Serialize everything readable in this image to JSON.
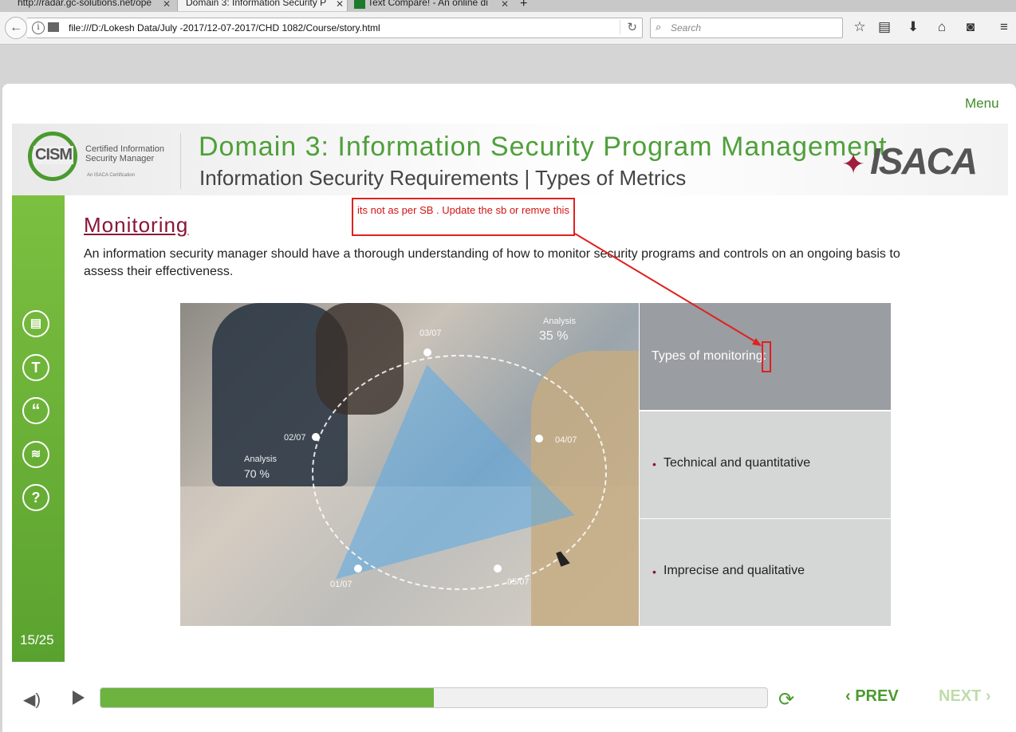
{
  "browser": {
    "tabs": [
      {
        "label": "http://radar.gc-solutions.net/ope"
      },
      {
        "label": "Domain 3: Information Security P"
      },
      {
        "label": "Text Compare! - An online di"
      }
    ],
    "url": "file:///D:/Lokesh Data/July -2017/12-07-2017/CHD 1082/Course/story.html",
    "search_placeholder": "Search"
  },
  "course": {
    "menu_label": "Menu",
    "logo_main": "CISM",
    "logo_sub": "Certified Information Security Manager",
    "logo_tag": "An ISACA Certification",
    "title": "Domain 3: Information Security Program Management",
    "subtitle": "Information Security Requirements | Types of Metrics",
    "brand": "ISACA",
    "heading": "Monitoring",
    "body": "An information security manager should have a thorough understanding of how to monitor security programs and controls on an ongoing basis to assess their effectiveness.",
    "panel_title": "Types of monitoring:",
    "panel_items": [
      "Technical and quantitative",
      "Imprecise and qualitative"
    ],
    "slide_counter": "15/25",
    "progress_fraction": 0.5,
    "prev_label": "PREV",
    "next_label": "NEXT"
  },
  "photo_labels": {
    "analysis_top": "Analysis",
    "analysis_top_value": "35 %",
    "analysis_left": "Analysis",
    "analysis_left_value": "70 %",
    "d1": "03/07",
    "d2": "02/07",
    "d3": "04/07",
    "d4": "01/07",
    "d5": "05/07"
  },
  "annotation": {
    "text": "its not as per SB . Update the sb or remve this",
    "color": "#e02020"
  },
  "colors": {
    "accent_green": "#4fa03a",
    "heading_maroon": "#8a1538",
    "progress_green": "#6db33f"
  }
}
